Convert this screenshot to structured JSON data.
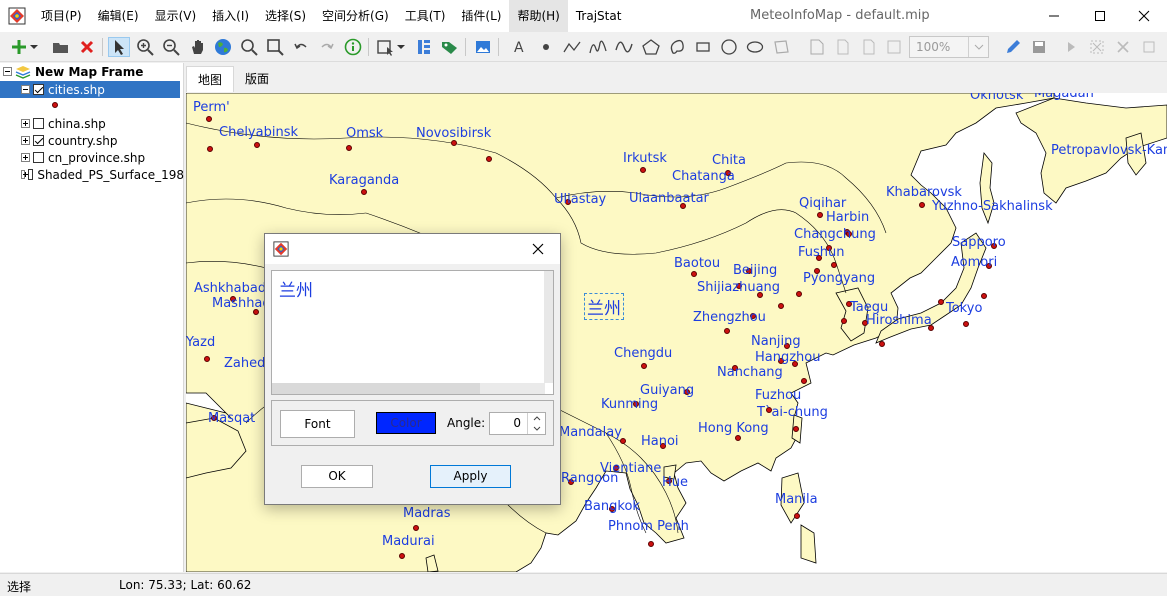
{
  "window": {
    "title": "MeteoInfoMap - default.mip",
    "menu": [
      "项目(P)",
      "编辑(E)",
      "显示(V)",
      "插入(I)",
      "选择(S)",
      "空间分析(G)",
      "工具(T)",
      "插件(L)",
      "帮助(H)",
      "TrajStat"
    ],
    "active_menu_index": 8
  },
  "toolbar": {
    "zoom_value": "100%"
  },
  "tree": {
    "frame_label": "New Map Frame",
    "layers": [
      {
        "label": "cities.shp",
        "checked": true,
        "expanded": true,
        "selected": true
      },
      {
        "label": "china.shp",
        "checked": false,
        "expanded": false,
        "selected": false
      },
      {
        "label": "country.shp",
        "checked": true,
        "expanded": false,
        "selected": false
      },
      {
        "label": "cn_province.shp",
        "checked": false,
        "expanded": false,
        "selected": false
      },
      {
        "label": "Shaded_PS_Surface_198",
        "checked": false,
        "expanded": false,
        "selected": false
      }
    ]
  },
  "tabs": [
    "地图",
    "版面"
  ],
  "map": {
    "selected_label": "兰州",
    "cities": [
      "Perm'",
      "Chelyabinsk",
      "Omsk",
      "Novosibirsk",
      "Okhotsk",
      "Magadan",
      "Irkutsk",
      "Chita",
      "Chatanga",
      "Petropavlovsk-Kam",
      "Karaganda",
      "Uliastay",
      "Ulaanbaatar",
      "Khabarovsk",
      "Qiqihar",
      "Yuzhno-Sakhalinsk",
      "Harbin",
      "Changchung",
      "Sapporo",
      "Fushun",
      "Aomori",
      "Baotou",
      "Beijing",
      "Shijiazhuang",
      "Pyongyang",
      "Ashkhabad",
      "Mashhad",
      "Taegu",
      "Tokyo",
      "Zhengzhou",
      "Hiroshima",
      "Yazd",
      "Nanjing",
      "Chengdu",
      "Hangzhou",
      "Zahedan",
      "Nanchang",
      "Guiyang",
      "Fuzhou",
      "Kunming",
      "Masqat",
      "T`ai-chung",
      "Mandalay",
      "Hong Kong",
      "Hanoi",
      "Vientiane",
      "Rangoon",
      "Hue",
      "Manila",
      "Bangkok",
      "Phnom Penh",
      "Madras",
      "Madurai"
    ]
  },
  "dialog": {
    "text_value": "兰州",
    "font_label": "Font",
    "color_label": "Color",
    "angle_label": "Angle:",
    "angle_value": "0",
    "ok_label": "OK",
    "apply_label": "Apply",
    "text_color": "#1c3de0",
    "swatch_color": "#0026ff"
  },
  "status": {
    "mode": "选择",
    "coords": "Lon: 75.33; Lat: 60.62"
  }
}
